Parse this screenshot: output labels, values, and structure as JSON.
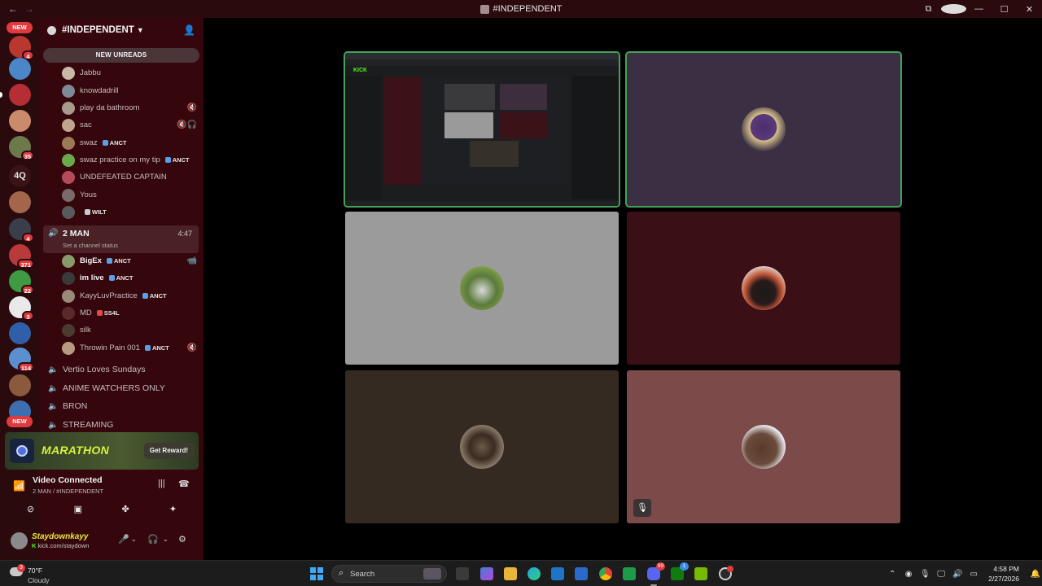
{
  "window": {
    "title": "#INDEPENDENT",
    "back": "←",
    "forward": "→",
    "controls": [
      "⧉",
      "?",
      "—",
      "☐",
      "✕"
    ]
  },
  "rail": {
    "new_top": "NEW",
    "new_bottom": "NEW",
    "text_server": "4Q",
    "badges": [
      "4",
      "35",
      "4",
      "371",
      "22",
      "3",
      "114"
    ]
  },
  "guild": {
    "name": "#INDEPENDENT",
    "new_unreads": "NEW UNREADS"
  },
  "channel_members": [
    {
      "name": "Jabbu"
    },
    {
      "name": "knowdadrill"
    },
    {
      "name": "play da bathroom"
    },
    {
      "name": "sac"
    },
    {
      "name": "swaz",
      "tag": "ANCT"
    },
    {
      "name": "swaz practice on my tip",
      "tag": "ANCT"
    },
    {
      "name": "UNDEFEATED CAPTAIN"
    },
    {
      "name": "Yous"
    },
    {
      "name": "",
      "tag": "WILT"
    }
  ],
  "active_channel": {
    "name": "2 MAN",
    "time": "4:47",
    "status": "Set a channel status"
  },
  "active_members": [
    {
      "name": "BigEx",
      "tag": "ANCT"
    },
    {
      "name": "im live",
      "tag": "ANCT"
    },
    {
      "name": "KayyLuvPractice",
      "tag": "ANCT"
    },
    {
      "name": "MD",
      "tag": "SS4L"
    },
    {
      "name": "silk"
    },
    {
      "name": "Throwin Pain 001",
      "tag": "ANCT"
    }
  ],
  "voice_channels": [
    "Vertio Loves Sundays",
    "ANIME WATCHERS ONLY",
    "BRON",
    "STREAMING"
  ],
  "promo": {
    "title": "MARATHON",
    "button": "Get Reward!"
  },
  "voice_status": {
    "title": "Video Connected",
    "subtitle": "2 MAN / #INDEPENDENT"
  },
  "user": {
    "name": "Staydownkayy",
    "status": "kick.com/staydown"
  },
  "stream": {
    "brand": "KICK"
  },
  "taskbar": {
    "temp": "70°F",
    "weather": "Cloudy",
    "weather_badge": "3",
    "search_placeholder": "Search",
    "discord_badge": "99",
    "xbox_badge": "1",
    "time": "4:58 PM",
    "date": "2/27/2026"
  },
  "colors": {
    "rail_bg": "#2b0a0e",
    "sidebar_bg": "#35070d",
    "speaking_outline": "#43a35b",
    "kick_green": "#53fc18"
  }
}
